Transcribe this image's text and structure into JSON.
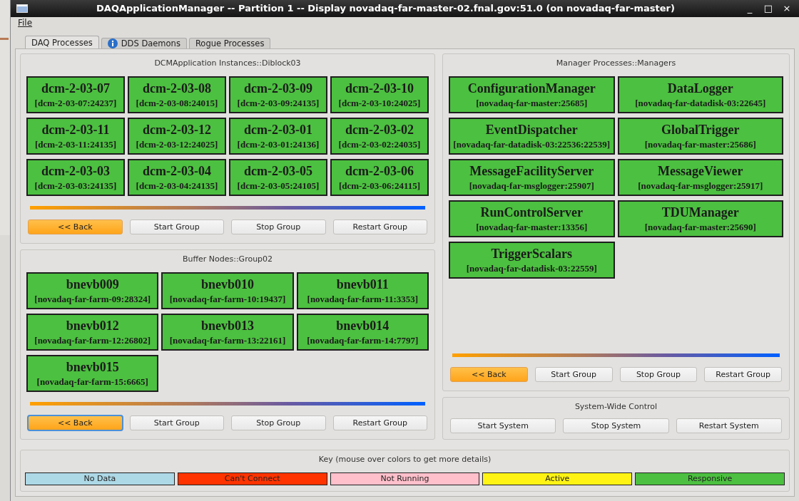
{
  "window": {
    "title": "DAQApplicationManager -- Partition 1 -- Display novadaq-far-master-02.fnal.gov:51.0 (on novadaq-far-master)",
    "controls": [
      "_",
      "□",
      "×"
    ]
  },
  "menu": [
    "File"
  ],
  "tabs": [
    {
      "label": "DAQ Processes",
      "selected": true,
      "info": false
    },
    {
      "label": "DDS Daemons",
      "selected": false,
      "info": true
    },
    {
      "label": "Rogue Processes",
      "selected": false,
      "info": false
    }
  ],
  "groups": [
    {
      "title": "DCMApplication Instances::Diblock03",
      "focused_back": false,
      "tiles": [
        {
          "name": "dcm-2-03-07",
          "address": "[dcm-2-03-07:24237]",
          "color": "#4cc040"
        },
        {
          "name": "dcm-2-03-08",
          "address": "[dcm-2-03-08:24015]",
          "color": "#4cc040"
        },
        {
          "name": "dcm-2-03-09",
          "address": "[dcm-2-03-09:24135]",
          "color": "#4cc040"
        },
        {
          "name": "dcm-2-03-10",
          "address": "[dcm-2-03-10:24025]",
          "color": "#4cc040"
        },
        {
          "name": "dcm-2-03-11",
          "address": "[dcm-2-03-11:24135]",
          "color": "#4cc040"
        },
        {
          "name": "dcm-2-03-12",
          "address": "[dcm-2-03-12:24025]",
          "color": "#4cc040"
        },
        {
          "name": "dcm-2-03-01",
          "address": "[dcm-2-03-01:24136]",
          "color": "#4cc040"
        },
        {
          "name": "dcm-2-03-02",
          "address": "[dcm-2-03-02:24035]",
          "color": "#4cc040"
        },
        {
          "name": "dcm-2-03-03",
          "address": "[dcm-2-03-03:24135]",
          "color": "#4cc040"
        },
        {
          "name": "dcm-2-03-04",
          "address": "[dcm-2-03-04:24135]",
          "color": "#4cc040"
        },
        {
          "name": "dcm-2-03-05",
          "address": "[dcm-2-03-05:24105]",
          "color": "#4cc040"
        },
        {
          "name": "dcm-2-03-06",
          "address": "[dcm-2-03-06:24115]",
          "color": "#4cc040"
        }
      ],
      "buttons": [
        {
          "label": "<< Back",
          "kind": "back"
        },
        {
          "label": "Start Group",
          "kind": "plain"
        },
        {
          "label": "Stop Group",
          "kind": "plain"
        },
        {
          "label": "Restart Group",
          "kind": "plain"
        }
      ]
    },
    {
      "title": "Buffer Nodes::Group02",
      "focused_back": true,
      "tiles": [
        {
          "name": "bnevb009",
          "address": "[novadaq-far-farm-09:28324]",
          "color": "#4cc040"
        },
        {
          "name": "bnevb010",
          "address": "[novadaq-far-farm-10:19437]",
          "color": "#4cc040"
        },
        {
          "name": "bnevb011",
          "address": "[novadaq-far-farm-11:3353]",
          "color": "#4cc040"
        },
        {
          "name": "bnevb012",
          "address": "[novadaq-far-farm-12:26802]",
          "color": "#4cc040"
        },
        {
          "name": "bnevb013",
          "address": "[novadaq-far-farm-13:22161]",
          "color": "#4cc040"
        },
        {
          "name": "bnevb014",
          "address": "[novadaq-far-farm-14:7797]",
          "color": "#4cc040"
        },
        {
          "name": "bnevb015",
          "address": "[novadaq-far-farm-15:6665]",
          "color": "#4cc040"
        }
      ],
      "buttons": [
        {
          "label": "<< Back",
          "kind": "back"
        },
        {
          "label": "Start Group",
          "kind": "plain"
        },
        {
          "label": "Stop Group",
          "kind": "plain"
        },
        {
          "label": "Restart Group",
          "kind": "plain"
        }
      ]
    },
    {
      "title": "Manager Processes::Managers",
      "focused_back": false,
      "tiles": [
        {
          "name": "ConfigurationManager",
          "address": "[novadaq-far-master:25685]",
          "color": "#4cc040"
        },
        {
          "name": "DataLogger",
          "address": "[novadaq-far-datadisk-03:22645]",
          "color": "#4cc040"
        },
        {
          "name": "EventDispatcher",
          "address": "[novadaq-far-datadisk-03:22536:22539]",
          "color": "#4cc040"
        },
        {
          "name": "GlobalTrigger",
          "address": "[novadaq-far-master:25686]",
          "color": "#4cc040"
        },
        {
          "name": "MessageFacilityServer",
          "address": "[novadaq-far-msglogger:25907]",
          "color": "#4cc040"
        },
        {
          "name": "MessageViewer",
          "address": "[novadaq-far-msglogger:25917]",
          "color": "#4cc040"
        },
        {
          "name": "RunControlServer",
          "address": "[novadaq-far-master:13356]",
          "color": "#4cc040"
        },
        {
          "name": "TDUManager",
          "address": "[novadaq-far-master:25690]",
          "color": "#4cc040"
        },
        {
          "name": "TriggerScalars",
          "address": "[novadaq-far-datadisk-03:22559]",
          "color": "#4cc040"
        }
      ],
      "buttons": [
        {
          "label": "<< Back",
          "kind": "back"
        },
        {
          "label": "Start Group",
          "kind": "plain"
        },
        {
          "label": "Stop Group",
          "kind": "plain"
        },
        {
          "label": "Restart Group",
          "kind": "plain"
        }
      ]
    }
  ],
  "system_control": {
    "title": "System-Wide Control",
    "buttons": [
      "Start System",
      "Stop System",
      "Restart System"
    ]
  },
  "key": {
    "title": "Key (mouse over colors to get more details)",
    "items": [
      {
        "label": "No Data",
        "color": "#add8e6"
      },
      {
        "label": "Can't Connect",
        "color": "#ff3300"
      },
      {
        "label": "Not Running",
        "color": "#ffc0cb"
      },
      {
        "label": "Active",
        "color": "#fff314"
      },
      {
        "label": "Responsive",
        "color": "#4cc040"
      }
    ]
  }
}
